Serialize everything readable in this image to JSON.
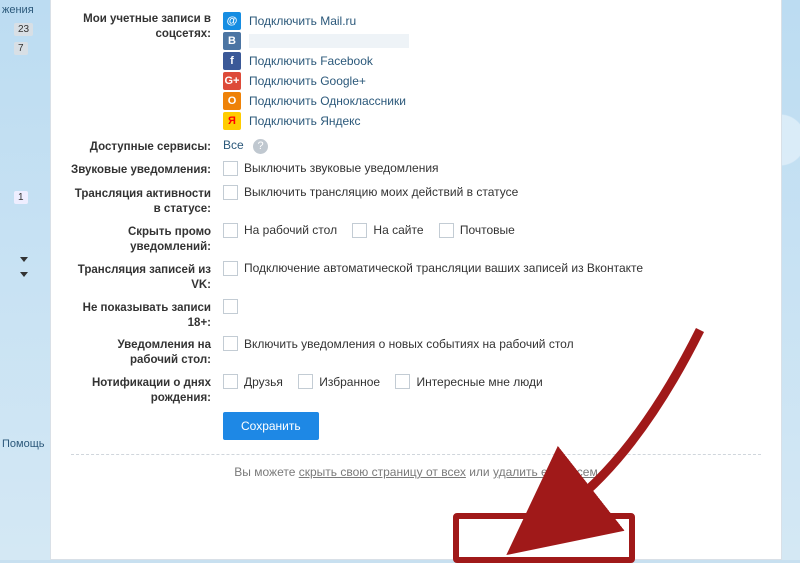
{
  "left": {
    "top_link": "жения",
    "badges": [
      "23",
      "7"
    ],
    "small_badge": "1",
    "help": "Помощь"
  },
  "sections": {
    "accounts_label": "Мои учетные записи в соцсетях:",
    "socials": {
      "mail": "Подключить Mail.ru",
      "fb": "Подключить Facebook",
      "gp": "Подключить Google+",
      "ok": "Подключить Одноклассники",
      "ya": "Подключить Яндекс"
    },
    "services_label": "Доступные сервисы:",
    "services_all": "Все",
    "sound_label": "Звуковые уведомления:",
    "sound_cb": "Выключить звуковые уведомления",
    "activity_label": "Трансляция активности в статусе:",
    "activity_cb": "Выключить трансляцию моих действий в статусе",
    "promo_label": "Скрыть промо уведомлений:",
    "promo": {
      "desk": "На рабочий стол",
      "site": "На сайте",
      "mail": "Почтовые"
    },
    "vk_label": "Трансляция записей из VK:",
    "vk_cb": "Подключение автоматической трансляции ваших записей из Вконтакте",
    "adult_label": "Не показывать записи 18+:",
    "desk_label": "Уведомления на рабочий стол:",
    "desk_cb": "Включить уведомления о новых событиях на рабочий стол",
    "bday_label": "Нотификации о днях рождения:",
    "bday": {
      "friends": "Друзья",
      "fav": "Избранное",
      "interest": "Интересные мне люди"
    },
    "save": "Сохранить"
  },
  "footer": {
    "pre": "Вы можете ",
    "hide": "скрыть свою страницу от всех",
    "mid": " или ",
    "del": "удалить её совсем"
  }
}
